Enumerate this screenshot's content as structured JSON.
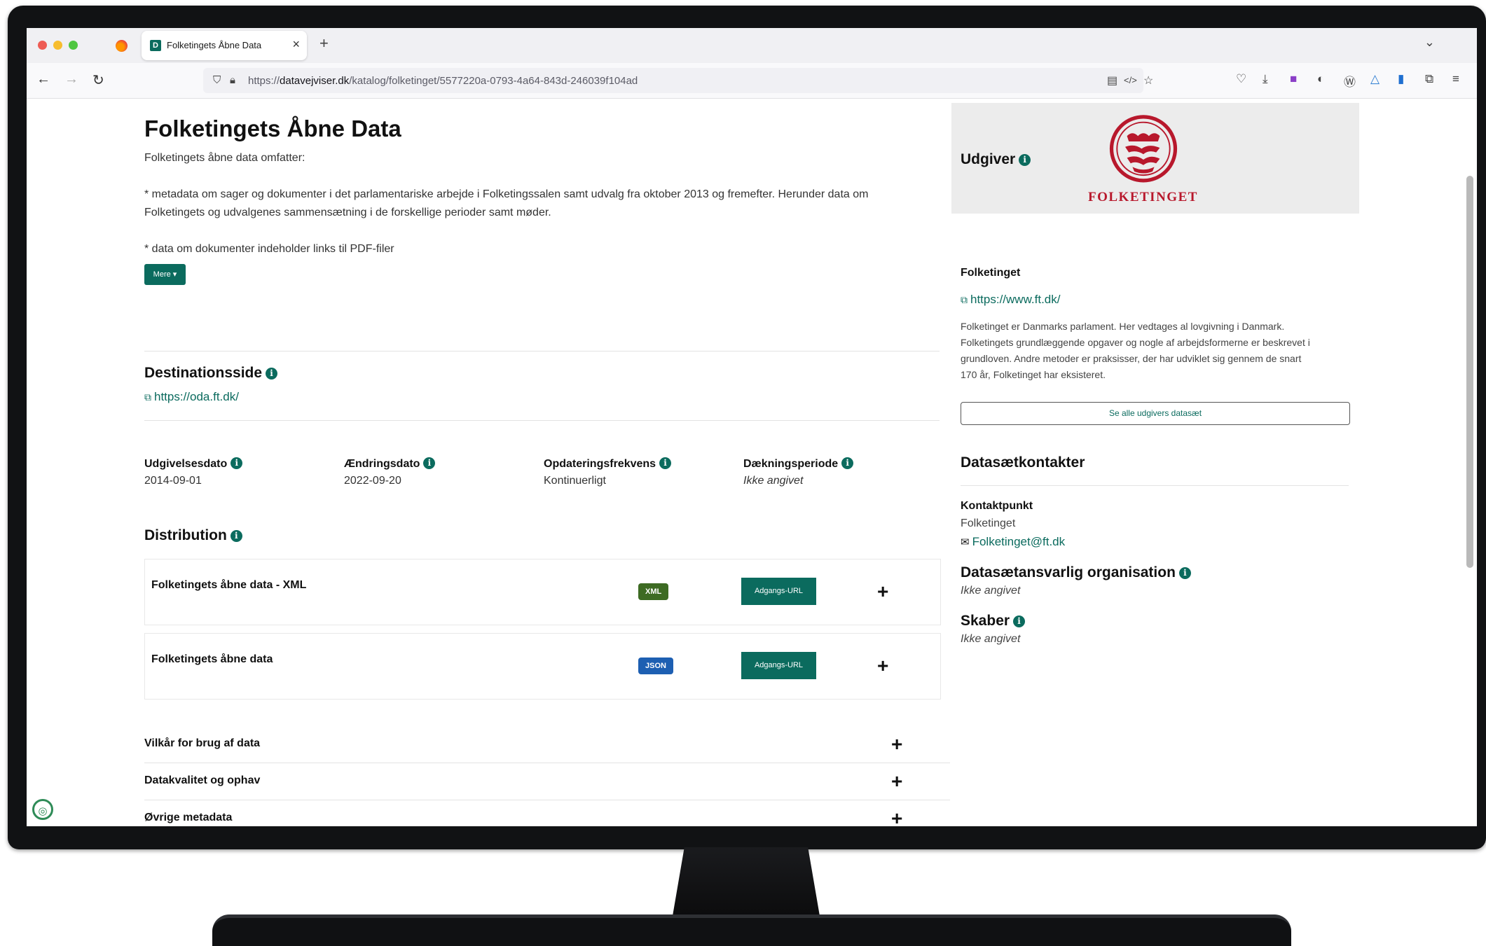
{
  "browser": {
    "tab_title": "Folketingets Åbne Data",
    "tab_favicon": "D",
    "url_prefix": "https://",
    "url_domain": "datavejviser.dk",
    "url_path": "/katalog/folketinget/5577220a-0793-4a64-843d-246039f104ad"
  },
  "main": {
    "title": "Folketingets Åbne Data",
    "intro": "Folketingets åbne data omfatter:",
    "bullet1_line1": "* metadata om sager og dokumenter i det parlamentariske arbejde i Folketingssalen samt udvalg fra oktober 2013 og fremefter. Herunder data om",
    "bullet1_line2": "Folketingets og udvalgenes sammensætning i de forskellige perioder samt møder.",
    "bullet2": "* data om dokumenter indeholder links til PDF-filer",
    "more_button": "Mere ▾",
    "destination_heading": "Destinationsside",
    "destination_url": "https://oda.ft.dk/",
    "meta": [
      {
        "label": "Udgivelsesdato",
        "value": "2014-09-01"
      },
      {
        "label": "Ændringsdato",
        "value": "2022-09-20"
      },
      {
        "label": "Opdateringsfrekvens",
        "value": "Kontinuerligt"
      },
      {
        "label": "Dækningsperiode",
        "value": "Ikke angivet"
      }
    ],
    "distribution_heading": "Distribution",
    "distributions": [
      {
        "title": "Folketingets åbne data - XML",
        "format": "XML",
        "access": "Adgangs-URL",
        "expand": "+"
      },
      {
        "title": "Folketingets åbne data",
        "format": "JSON",
        "access": "Adgangs-URL",
        "expand": "+"
      }
    ],
    "accordions": [
      {
        "label": "Vilkår for brug af data",
        "expand": "+"
      },
      {
        "label": "Datakvalitet og ophav",
        "expand": "+"
      },
      {
        "label": "Øvrige metadata",
        "expand": "+"
      }
    ]
  },
  "sidebar": {
    "publisher_label": "Udgiver",
    "logo_text": "FOLKETINGET",
    "publisher_name": "Folketinget",
    "publisher_url": "https://www.ft.dk/",
    "publisher_desc": [
      "Folketinget er Danmarks parlament. Her vedtages al lovgivning i Danmark.",
      "Folketingets grundlæggende opgaver og nogle af arbejdsformerne er beskrevet i",
      "grundloven. Andre metoder er praksisser, der har udviklet sig gennem de snart",
      "170 år, Folketinget har eksisteret."
    ],
    "see_all_button": "Se alle udgivers datasæt",
    "contacts_heading": "Datasætkontakter",
    "contact_point_label": "Kontaktpunkt",
    "contact_name": "Folketinget",
    "contact_email": "Folketinget@ft.dk",
    "responsible_heading": "Datasætansvarlig organisation",
    "responsible_value": "Ikke angivet",
    "creator_heading": "Skaber",
    "creator_value": "Ikke angivet"
  },
  "colors": {
    "accent": "#0b6b5e",
    "xml_badge": "#3d6b23",
    "json_badge": "#1d5fb2",
    "logo_red": "#b8182c"
  }
}
